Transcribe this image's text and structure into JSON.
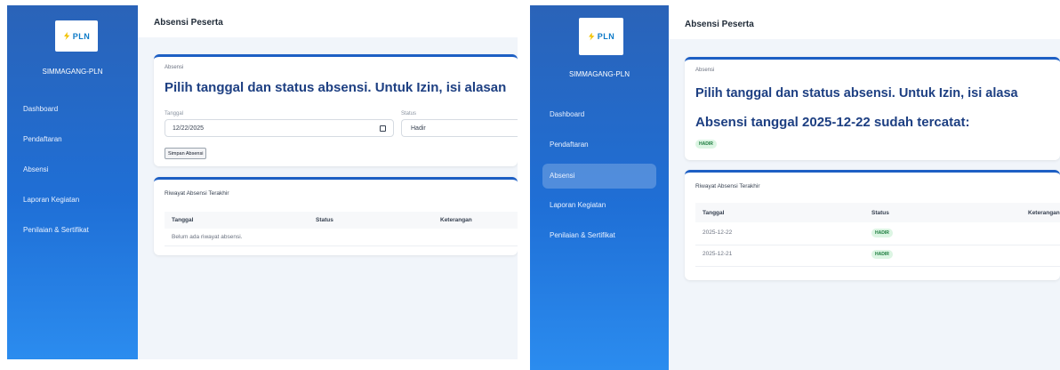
{
  "app": {
    "logo_text": "PLN",
    "brand": "SIMMAGANG-PLN",
    "page_title": "Absensi Peserta",
    "nav": [
      "Dashboard",
      "Pendaftaran",
      "Absensi",
      "Laporan Kegiatan",
      "Penilaian & Sertifikat"
    ],
    "active_nav": "Absensi"
  },
  "left": {
    "card_label": "Absensi",
    "headline": "Pilih tanggal dan status absensi. Untuk Izin, isi alasan",
    "date_label": "Tanggal",
    "date_value": "12/22/2025",
    "status_label": "Status",
    "status_value": "Hadir",
    "save_button": "Simpan Absensi",
    "history_title": "Riwayat Absensi Terakhir",
    "columns": [
      "Tanggal",
      "Status",
      "Keterangan"
    ],
    "empty_text": "Belum ada riwayat absensi."
  },
  "right": {
    "card_label": "Absensi",
    "headline": "Pilih tanggal dan status absensi. Untuk Izin, isi alasa",
    "recorded_text": "Absensi tanggal 2025-12-22 sudah tercatat:",
    "recorded_status": "HADIR",
    "history_title": "Riwayat Absensi Terakhir",
    "columns": [
      "Tanggal",
      "Status",
      "Keterangan"
    ],
    "rows": [
      {
        "date": "2025-12-22",
        "status": "HADIR"
      },
      {
        "date": "2025-12-21",
        "status": "HADIR"
      }
    ]
  },
  "colors": {
    "sidebar": "#1f6fd6",
    "accent": "#1d5fc4",
    "headline": "#1d3f82",
    "badge_bg": "#dcf5e3",
    "badge_text": "#1a7a3c"
  }
}
